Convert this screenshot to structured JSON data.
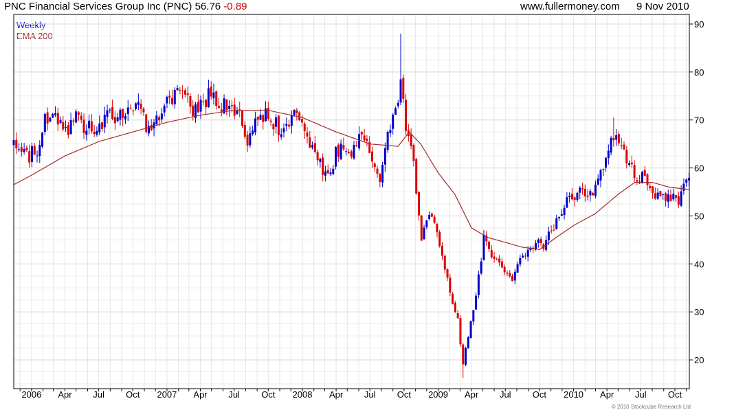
{
  "header": {
    "title": "PNC Financial Services Group Inc (PNC)",
    "price": "56.76",
    "change": "-0.89",
    "site": "www.fullermoney.com",
    "date": "9 Nov 2010"
  },
  "legend": {
    "period": "Weekly",
    "ema": "EMA 200"
  },
  "copyright": "© 2010 Stockcube Research Ltd",
  "colors": {
    "up": "#0000cc",
    "down": "#dd0000",
    "ema": "#a52a2a",
    "grid": "#dddddd",
    "frame": "#000000"
  },
  "chart_data": {
    "type": "candlestick",
    "title": "PNC Financial Services Group Inc (PNC)",
    "y_axis": {
      "min": 14,
      "max": 92,
      "ticks": [
        20,
        30,
        40,
        50,
        60,
        70,
        80,
        90
      ],
      "position": "right"
    },
    "x_axis": {
      "start": "2005-11-14",
      "end": "2010-11-09",
      "ticks": [
        {
          "label": "2006",
          "date": "2006-01-01"
        },
        {
          "label": "Apr",
          "date": "2006-04-01"
        },
        {
          "label": "Jul",
          "date": "2006-07-01"
        },
        {
          "label": "Oct",
          "date": "2006-10-01"
        },
        {
          "label": "2007",
          "date": "2007-01-01"
        },
        {
          "label": "Apr",
          "date": "2007-04-01"
        },
        {
          "label": "Jul",
          "date": "2007-07-01"
        },
        {
          "label": "Oct",
          "date": "2007-10-01"
        },
        {
          "label": "2008",
          "date": "2008-01-01"
        },
        {
          "label": "Apr",
          "date": "2008-04-01"
        },
        {
          "label": "Jul",
          "date": "2008-07-01"
        },
        {
          "label": "Oct",
          "date": "2008-10-01"
        },
        {
          "label": "2009",
          "date": "2009-01-01"
        },
        {
          "label": "Apr",
          "date": "2009-04-01"
        },
        {
          "label": "Jul",
          "date": "2009-07-01"
        },
        {
          "label": "Oct",
          "date": "2009-10-01"
        },
        {
          "label": "2010",
          "date": "2010-01-01"
        },
        {
          "label": "Apr",
          "date": "2010-04-01"
        },
        {
          "label": "Jul",
          "date": "2010-07-01"
        },
        {
          "label": "Oct",
          "date": "2010-10-01"
        }
      ]
    },
    "price_path": [
      [
        "2005-11-14",
        64.5
      ],
      [
        "2005-12-05",
        63.5
      ],
      [
        "2005-12-26",
        62.5
      ],
      [
        "2006-01-16",
        64.0
      ],
      [
        "2006-02-06",
        70.5
      ],
      [
        "2006-02-27",
        71.0
      ],
      [
        "2006-03-20",
        69.0
      ],
      [
        "2006-04-10",
        67.0
      ],
      [
        "2006-05-01",
        71.5
      ],
      [
        "2006-05-22",
        68.5
      ],
      [
        "2006-06-12",
        68.0
      ],
      [
        "2006-07-03",
        69.5
      ],
      [
        "2006-07-24",
        70.5
      ],
      [
        "2006-08-14",
        71.0
      ],
      [
        "2006-09-04",
        71.5
      ],
      [
        "2006-09-25",
        72.5
      ],
      [
        "2006-10-16",
        73.5
      ],
      [
        "2006-11-06",
        69.0
      ],
      [
        "2006-11-27",
        69.0
      ],
      [
        "2006-12-18",
        72.0
      ],
      [
        "2007-01-08",
        74.0
      ],
      [
        "2007-01-29",
        75.5
      ],
      [
        "2007-02-19",
        74.5
      ],
      [
        "2007-03-12",
        71.5
      ],
      [
        "2007-04-02",
        72.5
      ],
      [
        "2007-04-23",
        75.0
      ],
      [
        "2007-05-14",
        74.5
      ],
      [
        "2007-06-04",
        73.0
      ],
      [
        "2007-06-25",
        72.5
      ],
      [
        "2007-07-16",
        71.0
      ],
      [
        "2007-08-06",
        66.0
      ],
      [
        "2007-08-27",
        69.5
      ],
      [
        "2007-09-17",
        71.0
      ],
      [
        "2007-10-08",
        70.5
      ],
      [
        "2007-10-29",
        68.0
      ],
      [
        "2007-11-19",
        69.5
      ],
      [
        "2007-12-10",
        71.0
      ],
      [
        "2008-01-07",
        67.0
      ],
      [
        "2008-01-28",
        64.0
      ],
      [
        "2008-02-18",
        61.0
      ],
      [
        "2008-03-10",
        57.5
      ],
      [
        "2008-03-31",
        63.0
      ],
      [
        "2008-04-21",
        64.5
      ],
      [
        "2008-05-12",
        62.0
      ],
      [
        "2008-06-02",
        66.0
      ],
      [
        "2008-06-23",
        65.0
      ],
      [
        "2008-07-14",
        60.0
      ],
      [
        "2008-07-28",
        57.0
      ],
      [
        "2008-08-11",
        64.0
      ],
      [
        "2008-09-01",
        70.0
      ],
      [
        "2008-09-22",
        77.0
      ],
      [
        "2008-10-06",
        69.0
      ],
      [
        "2008-10-27",
        60.0
      ],
      [
        "2008-11-17",
        45.0
      ],
      [
        "2008-12-08",
        50.0
      ],
      [
        "2008-12-29",
        47.0
      ],
      [
        "2009-01-19",
        39.0
      ],
      [
        "2009-02-09",
        31.0
      ],
      [
        "2009-02-23",
        28.0
      ],
      [
        "2009-03-09",
        19.0
      ],
      [
        "2009-03-23",
        25.0
      ],
      [
        "2009-04-13",
        33.0
      ],
      [
        "2009-05-04",
        45.0
      ],
      [
        "2009-05-25",
        42.0
      ],
      [
        "2009-06-15",
        40.0
      ],
      [
        "2009-07-06",
        38.0
      ],
      [
        "2009-07-20",
        36.0
      ],
      [
        "2009-08-10",
        41.0
      ],
      [
        "2009-08-31",
        43.0
      ],
      [
        "2009-09-21",
        44.0
      ],
      [
        "2009-10-12",
        44.0
      ],
      [
        "2009-11-02",
        47.0
      ],
      [
        "2009-11-23",
        50.0
      ],
      [
        "2009-12-14",
        53.0
      ],
      [
        "2010-01-04",
        54.0
      ],
      [
        "2010-01-25",
        56.0
      ],
      [
        "2010-02-15",
        54.0
      ],
      [
        "2010-03-08",
        57.0
      ],
      [
        "2010-03-29",
        62.0
      ],
      [
        "2010-04-19",
        67.0
      ],
      [
        "2010-05-10",
        64.0
      ],
      [
        "2010-05-31",
        60.0
      ],
      [
        "2010-06-21",
        58.0
      ],
      [
        "2010-07-12",
        58.0
      ],
      [
        "2010-08-02",
        56.0
      ],
      [
        "2010-08-23",
        53.0
      ],
      [
        "2010-09-13",
        54.0
      ],
      [
        "2010-10-04",
        53.0
      ],
      [
        "2010-10-18",
        54.0
      ],
      [
        "2010-11-01",
        57.5
      ],
      [
        "2010-11-09",
        56.76
      ]
    ],
    "ema_path": [
      [
        "2005-11-14",
        56.5
      ],
      [
        "2006-01-01",
        58.5
      ],
      [
        "2006-04-01",
        62.5
      ],
      [
        "2006-07-01",
        65.5
      ],
      [
        "2006-10-01",
        67.5
      ],
      [
        "2007-01-01",
        69.5
      ],
      [
        "2007-04-01",
        71.0
      ],
      [
        "2007-07-01",
        72.0
      ],
      [
        "2007-10-01",
        72.0
      ],
      [
        "2008-01-01",
        70.5
      ],
      [
        "2008-04-01",
        67.5
      ],
      [
        "2008-07-01",
        65.0
      ],
      [
        "2008-09-15",
        64.5
      ],
      [
        "2008-10-15",
        67.5
      ],
      [
        "2008-11-15",
        65.0
      ],
      [
        "2009-01-01",
        59.0
      ],
      [
        "2009-02-15",
        54.5
      ],
      [
        "2009-04-01",
        47.5
      ],
      [
        "2009-05-15",
        45.5
      ],
      [
        "2009-07-01",
        44.5
      ],
      [
        "2009-08-15",
        43.5
      ],
      [
        "2009-10-01",
        43.0
      ],
      [
        "2009-11-15",
        45.5
      ],
      [
        "2010-01-01",
        48.0
      ],
      [
        "2010-03-01",
        50.5
      ],
      [
        "2010-05-01",
        54.5
      ],
      [
        "2010-06-15",
        57.0
      ],
      [
        "2010-08-01",
        57.0
      ],
      [
        "2010-09-15",
        56.0
      ],
      [
        "2010-11-09",
        55.5
      ]
    ],
    "notable_points": [
      {
        "date": "2008-09-22",
        "high": 88.0
      },
      {
        "date": "2009-03-09",
        "low": 16.2
      },
      {
        "date": "2010-04-19",
        "high": 70.5
      }
    ]
  }
}
